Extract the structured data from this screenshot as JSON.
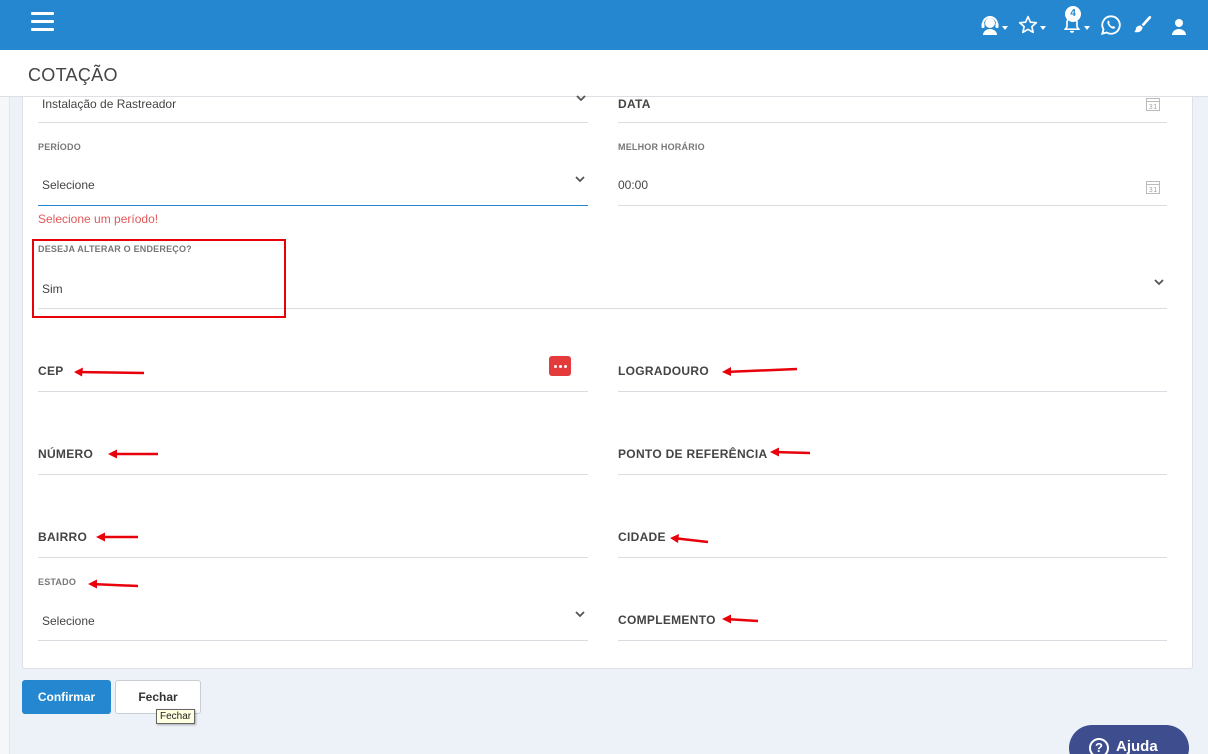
{
  "header": {
    "notification_count": "4",
    "brand_color": "#2487cf"
  },
  "page": {
    "title": "COTAÇÃO"
  },
  "form": {
    "service_type": {
      "value": "Instalação de Rastreador"
    },
    "date": {
      "label": "DATA"
    },
    "period": {
      "label": "PERÍODO",
      "value": "Selecione",
      "error": "Selecione um período!"
    },
    "best_time": {
      "label": "MELHOR HORÁRIO",
      "value": "00:00"
    },
    "change_address": {
      "label": "DESEJA ALTERAR O ENDEREÇO?",
      "value": "Sim"
    },
    "cep": {
      "label": "CEP"
    },
    "street": {
      "label": "LOGRADOURO"
    },
    "number": {
      "label": "NÚMERO"
    },
    "reference": {
      "label": "PONTO DE REFERÊNCIA"
    },
    "district": {
      "label": "BAIRRO"
    },
    "city": {
      "label": "CIDADE"
    },
    "state": {
      "label": "ESTADO",
      "value": "Selecione"
    },
    "complement": {
      "label": "COMPLEMENTO"
    }
  },
  "actions": {
    "confirm_label": "Confirmar",
    "close_label": "Fechar",
    "close_tooltip": "Fechar"
  },
  "help": {
    "label": "Ajuda"
  },
  "annotation_color": "#e8000b"
}
